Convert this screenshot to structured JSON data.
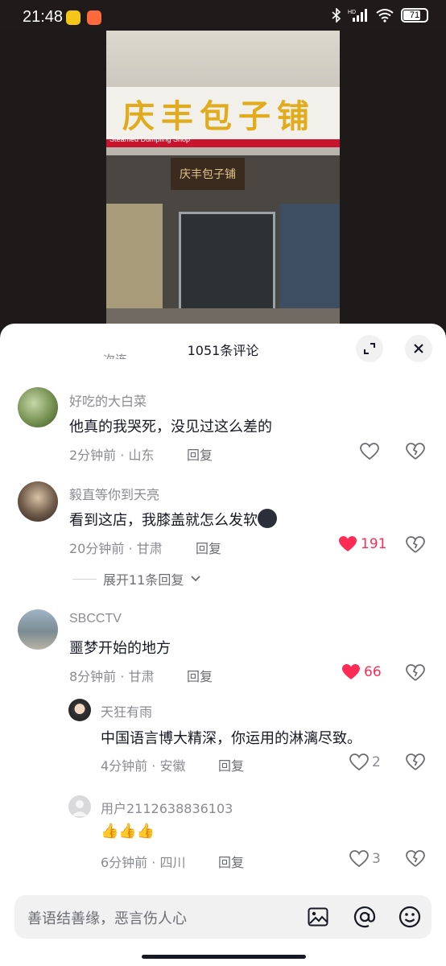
{
  "status_bar": {
    "time": "21:48",
    "battery": "71",
    "icons": [
      "bluetooth-icon",
      "hd-signal-icon",
      "wifi-icon",
      "battery-icon"
    ]
  },
  "video": {
    "sign_text": "庆丰包子铺",
    "sign_sub": "Steamed Dumpling Shop",
    "inner_sign": "庆丰包子铺"
  },
  "sheet": {
    "title": "1051条评论",
    "cutoff_text": "次连"
  },
  "comments": [
    {
      "username": "好吃的大白菜",
      "text": "他真的我哭死，没见过这么差的",
      "time": "2分钟前",
      "location": "山东",
      "reply_label": "回复",
      "likes": "",
      "liked": false
    },
    {
      "username": "毅直等你到天亮",
      "text": "看到这店，我膝盖就怎么发软",
      "emoji": "😶",
      "time": "20分钟前",
      "location": "甘肃",
      "reply_label": "回复",
      "likes": "191",
      "liked": true,
      "expand_label": "展开11条回复"
    },
    {
      "username": "SBCCTV",
      "text": "噩梦开始的地方",
      "time": "8分钟前",
      "location": "甘肃",
      "reply_label": "回复",
      "likes": "66",
      "liked": true
    }
  ],
  "replies": [
    {
      "username": "天狂有雨",
      "text": "中国语言博大精深，你运用的淋漓尽致。",
      "time": "4分钟前",
      "location": "安徽",
      "reply_label": "回复",
      "likes": "2",
      "liked": false
    },
    {
      "username": "用户2112638836103",
      "text": "👍👍👍",
      "time": "6分钟前",
      "location": "四川",
      "reply_label": "回复",
      "likes": "3",
      "liked": false
    }
  ],
  "input": {
    "placeholder": "善语结善缘，恶言伤人心"
  },
  "colors": {
    "accent": "#fe2c55",
    "text_primary": "#161823",
    "text_secondary": "#8a8b91"
  }
}
